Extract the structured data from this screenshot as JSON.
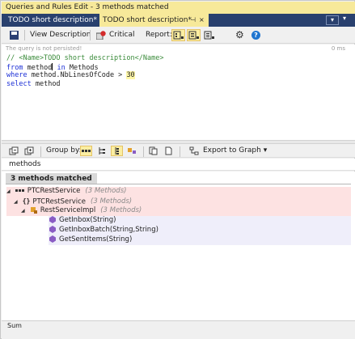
{
  "window": {
    "title": "Queries and Rules Edit  - 3 methods matched"
  },
  "tabs": [
    {
      "label": "TODO short description*"
    },
    {
      "label": "TODO short description*",
      "pin": "⊣",
      "close": "×"
    }
  ],
  "toolbar": {
    "view_description": "View Description",
    "critical": "Critical",
    "report": "Report:"
  },
  "status": {
    "message": "The query is not persisted!",
    "time": "0 ms"
  },
  "editor": {
    "line1_comment": "// <Name>TODO short description</Name>",
    "line2_kw": "from",
    "line2_ident": "method",
    "line2_in": "in",
    "line2_rest": "Methods",
    "line3_kw": "where",
    "line3_expr": "method.NbLinesOfCode >",
    "line3_num": "30",
    "line4_kw": "select",
    "line4_ident": "method"
  },
  "results_toolbar": {
    "group_by": "Group by:",
    "export": "Export to Graph"
  },
  "search": {
    "value": "methods"
  },
  "matched": {
    "label": "3 methods matched"
  },
  "tree": {
    "assembly": {
      "name": "PTCRestService",
      "count": "(3 Methods)"
    },
    "namespace": {
      "name": "PTCRestService",
      "count": "(3 Methods)"
    },
    "type": {
      "name": "RestServiceImpl",
      "count": "(3 Methods)"
    },
    "methods": [
      "GetInbox(String)",
      "GetInboxBatch(String,String)",
      "GetSentItems(String)"
    ]
  },
  "footer": {
    "sum_label": "Sum"
  },
  "colors": {
    "accent_yellow": "#f7e99a",
    "tab_strip": "#29406e",
    "keyword_blue": "#1c2fd6",
    "comment_green": "#3a8b3a",
    "row_pink": "#fde2e2",
    "row_lavender": "#efeefa"
  },
  "icons": {
    "save": "save-icon",
    "critical": "critical-icon",
    "settings": "gear-icon",
    "help": "help-icon"
  }
}
